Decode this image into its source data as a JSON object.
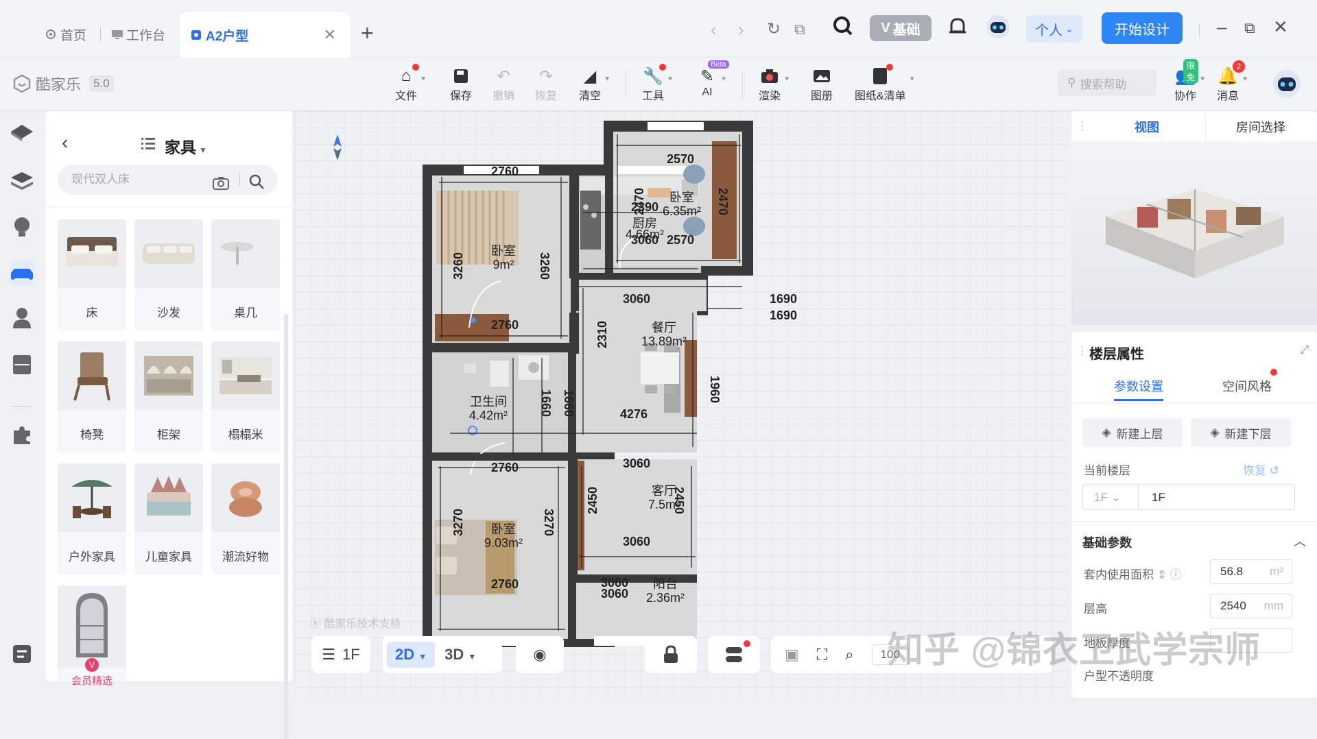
{
  "titlebar": {
    "tabs": [
      {
        "label": "首页"
      },
      {
        "label": "工作台"
      },
      {
        "label": "A2户型"
      }
    ],
    "basic_label": "基础",
    "personal_label": "个人",
    "start_design_label": "开始设计"
  },
  "app": {
    "name": "酷家乐",
    "version": "5.0"
  },
  "toolbar": {
    "file": "文件",
    "save": "保存",
    "undo": "撤销",
    "redo": "恢复",
    "clear": "清空",
    "tools": "工具",
    "ai": "AI",
    "ai_badge": "Beta",
    "render": "渲染",
    "album": "图册",
    "drawings": "图纸&清单",
    "search_help_placeholder": "搜索帮助",
    "collab": "协作",
    "collab_badge": "限免",
    "messages": "消息",
    "messages_count": "2"
  },
  "furniture_panel": {
    "title": "家具",
    "search_placeholder": "现代双人床",
    "items": [
      {
        "label": "床"
      },
      {
        "label": "沙发"
      },
      {
        "label": "桌几"
      },
      {
        "label": "椅凳"
      },
      {
        "label": "柜架"
      },
      {
        "label": "榻榻米"
      },
      {
        "label": "户外家具"
      },
      {
        "label": "儿童家具"
      },
      {
        "label": "潮流好物"
      },
      {
        "label": "会员精选"
      }
    ]
  },
  "floorplan": {
    "rooms": [
      {
        "name": "卧室",
        "area": "9m²"
      },
      {
        "name": "厨房",
        "area": "4.66m²"
      },
      {
        "name": "卧室",
        "area": "6.35m²"
      },
      {
        "name": "餐厅",
        "area": "13.89m²"
      },
      {
        "name": "卫生间",
        "area": "4.42m²"
      },
      {
        "name": "客厅",
        "area": "7.5m²"
      },
      {
        "name": "卧室",
        "area": "9.03m²"
      },
      {
        "name": "阳台",
        "area": "2.36m²"
      }
    ],
    "dims": [
      "2760",
      "3260",
      "3260",
      "2760",
      "2390",
      "3060",
      "2570",
      "2470",
      "2470",
      "2570",
      "3060",
      "1690",
      "1690",
      "2310",
      "1960",
      "1660",
      "1660",
      "4276",
      "2760",
      "3270",
      "3270",
      "2760",
      "3060",
      "2450",
      "2450",
      "3060",
      "3060",
      "3060"
    ]
  },
  "canvas": {
    "watermark": "酷家乐技术支持",
    "overlay_watermark": "知乎 @锦衣卫武学宗师"
  },
  "bottom_bar": {
    "floor": "1F",
    "mode_2d": "2D",
    "mode_3d": "3D",
    "zoom": "100"
  },
  "right_panel": {
    "tab_view": "视图",
    "tab_room_select": "房间选择",
    "floor_props_title": "楼层属性",
    "tab_params": "参数设置",
    "tab_style": "空间风格",
    "new_upper": "新建上层",
    "new_lower": "新建下层",
    "current_floor_label": "当前楼层",
    "restore_label": "恢复",
    "floor_select": "1F",
    "floor_name": "1F",
    "basic_params": "基础参数",
    "area_label": "套内使用面积",
    "area_value": "56.8",
    "area_unit": "m²",
    "height_label": "层高",
    "height_value": "2540",
    "height_unit": "mm",
    "floor_thickness_label": "地板厚度",
    "opacity_label": "户型不透明度"
  },
  "colors": {
    "accent": "#2e86f5",
    "wall": "#3a3a3a",
    "floor": "#d9d9d9",
    "wood": "#8b5a3c"
  }
}
